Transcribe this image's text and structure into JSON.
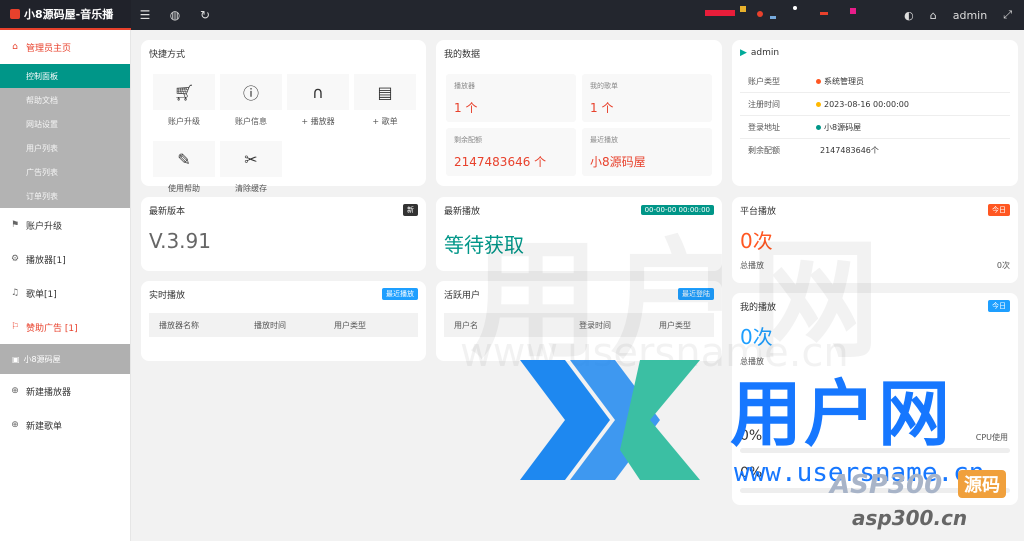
{
  "app": {
    "title": "小8源码屋-音乐播"
  },
  "topbar": {
    "user": "admin"
  },
  "sidebar": {
    "home": "管理员主页",
    "sub": [
      "控制面板",
      "帮助文档",
      "网站设置",
      "用户列表",
      "广告列表",
      "订单列表"
    ],
    "upgrade": "账户升级",
    "players": "播放器[1]",
    "songlists": "歌单[1]",
    "ads": "赞助广告 [1]",
    "band": "小8源码屋",
    "new_player": "新建播放器",
    "new_list": "新建歌单"
  },
  "quick": {
    "title": "快捷方式",
    "items": [
      {
        "label": "账户升级",
        "icon": "cart-icon"
      },
      {
        "label": "账户信息",
        "icon": "info-icon"
      },
      {
        "label": "+ 播放器",
        "icon": "headphones-icon"
      },
      {
        "label": "+ 歌单",
        "icon": "clipboard-icon"
      },
      {
        "label": "使用帮助",
        "icon": "edit-icon"
      },
      {
        "label": "清除缓存",
        "icon": "broom-icon"
      }
    ]
  },
  "mydata": {
    "title": "我的数据",
    "items": [
      {
        "label": "播放器",
        "value": "1 个"
      },
      {
        "label": "我的歌单",
        "value": "1 个"
      },
      {
        "label": "剩余配额",
        "value": "2147483646 个"
      },
      {
        "label": "最近播放",
        "value": "小8源码屋"
      }
    ]
  },
  "account": {
    "name": "admin",
    "rows": [
      {
        "k": "账户类型",
        "v": "系统管理员",
        "dot": "#ff5722"
      },
      {
        "k": "注册时间",
        "v": "2023-08-16 00:00:00",
        "dot": "#ffb800"
      },
      {
        "k": "登录地址",
        "v": "小8源码屋",
        "dot": "#009688"
      },
      {
        "k": "剩余配额",
        "v": "2147483646个",
        "dot": ""
      }
    ]
  },
  "version": {
    "title": "最新版本",
    "badge": "新",
    "value": "V.3.91"
  },
  "latest_play": {
    "title": "最新播放",
    "badge": "00-00-00 00:00:00",
    "value": "等待获取"
  },
  "platform": {
    "title": "平台播放",
    "badge": "今日",
    "value": "0次",
    "foot_label": "总播放",
    "foot_value": "0次"
  },
  "realtime": {
    "title": "实时播放",
    "badge": "最近播放",
    "cols": [
      "播放器名称",
      "播放时间",
      "用户类型"
    ]
  },
  "active_users": {
    "title": "活跃用户",
    "badge": "最近登陆",
    "cols": [
      "用户名",
      "登录时间",
      "用户类型"
    ]
  },
  "myplay": {
    "title": "我的播放",
    "badge": "今日",
    "value": "0次",
    "foot_label": "总播放",
    "cpu_pct": "0%",
    "cpu_label": "CPU使用",
    "mem_pct": "0%"
  },
  "watermark": {
    "brand": "用户网",
    "url": "www.usersname.cn",
    "asp": "ASP300",
    "asp_badge": "源码",
    "asp_url": "asp300.cn"
  }
}
